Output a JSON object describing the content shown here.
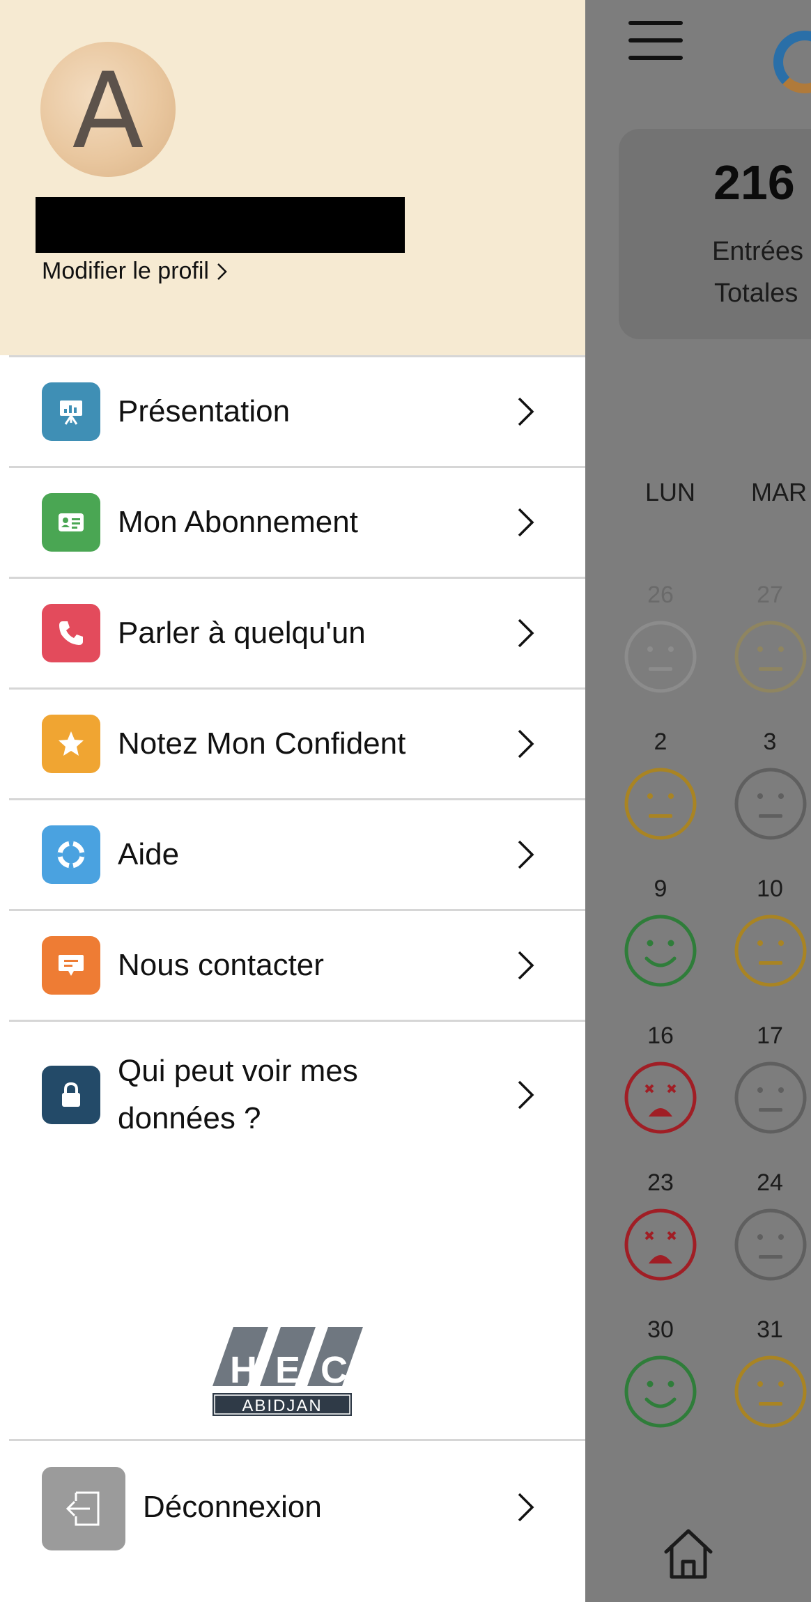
{
  "profile": {
    "avatar_letter": "A",
    "edit_profile_label": "Modifier le profil"
  },
  "menu": {
    "items": [
      {
        "label": "Présentation",
        "icon": "presentation-icon",
        "color": "#3f8fb5"
      },
      {
        "label": "Mon Abonnement",
        "icon": "id-card-icon",
        "color": "#4aa653"
      },
      {
        "label": "Parler à quelqu'un",
        "icon": "phone-icon",
        "color": "#e34b5c"
      },
      {
        "label": "Notez Mon Confident",
        "icon": "star-icon",
        "color": "#f0a532"
      },
      {
        "label": "Aide",
        "icon": "lifebuoy-icon",
        "color": "#4aa2e0"
      },
      {
        "label": "Nous contacter",
        "icon": "chat-icon",
        "color": "#ee7c34"
      },
      {
        "label": "Qui peut voir mes données ?",
        "icon": "lock-icon",
        "color": "#234a68"
      }
    ]
  },
  "school_logo": {
    "letters": [
      "H",
      "E",
      "C"
    ],
    "city": "ABIDJAN"
  },
  "logout": {
    "label": "Déconnexion",
    "icon": "logout-icon",
    "color": "#9b9b9b"
  },
  "background": {
    "stats": {
      "value": "216",
      "label_line1": "Entrées",
      "label_line2": "Totales"
    },
    "calendar": {
      "day_headers": [
        "LUN",
        "MAR"
      ],
      "weeks": [
        {
          "days": [
            "26",
            "27"
          ],
          "moods": [
            "neutral-faded",
            "neutral-faded-gold"
          ]
        },
        {
          "days": [
            "2",
            "3"
          ],
          "moods": [
            "neutral-gold",
            "neutral-gray"
          ]
        },
        {
          "days": [
            "9",
            "10"
          ],
          "moods": [
            "happy-green",
            "neutral-gold"
          ]
        },
        {
          "days": [
            "16",
            "17"
          ],
          "moods": [
            "sad-red",
            "neutral-gray"
          ]
        },
        {
          "days": [
            "23",
            "24"
          ],
          "moods": [
            "sad-red",
            "neutral-gray"
          ]
        },
        {
          "days": [
            "30",
            "31"
          ],
          "moods": [
            "happy-green",
            "neutral-gold"
          ]
        }
      ]
    },
    "colors": {
      "green": "#2f7d3a",
      "gold": "#a98423",
      "red": "#a01e25",
      "gray": "#5f5f5f"
    }
  }
}
